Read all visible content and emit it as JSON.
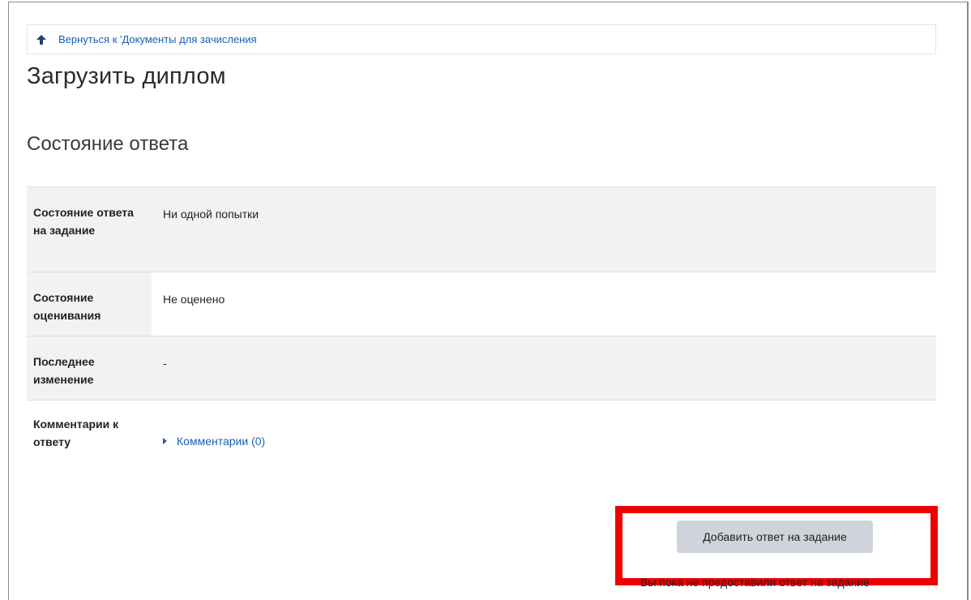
{
  "navigation": {
    "back_link": "Вернуться к 'Документы для зачисления"
  },
  "page": {
    "title": "Загрузить диплом",
    "section_title": "Состояние ответа"
  },
  "status_table": {
    "rows": [
      {
        "label": "Состояние ответа на задание",
        "value": "Ни одной попытки"
      },
      {
        "label": "Состояние оценивания",
        "value": "Не оценено"
      },
      {
        "label": "Последнее изменение",
        "value": "-"
      },
      {
        "label": "Комментарии к ответу",
        "value": "Комментарии (0)"
      }
    ]
  },
  "actions": {
    "add_submission_label": "Добавить ответ на задание",
    "note": "Вы пока не предоставили ответ на задание"
  },
  "icons": {
    "back": "arrow-up-icon",
    "comments_toggle": "caret-right-icon"
  },
  "colors": {
    "link": "#1a5fb4",
    "highlight": "#ee0000",
    "button": "#ced4da",
    "row_shade": "#f2f2f2"
  }
}
